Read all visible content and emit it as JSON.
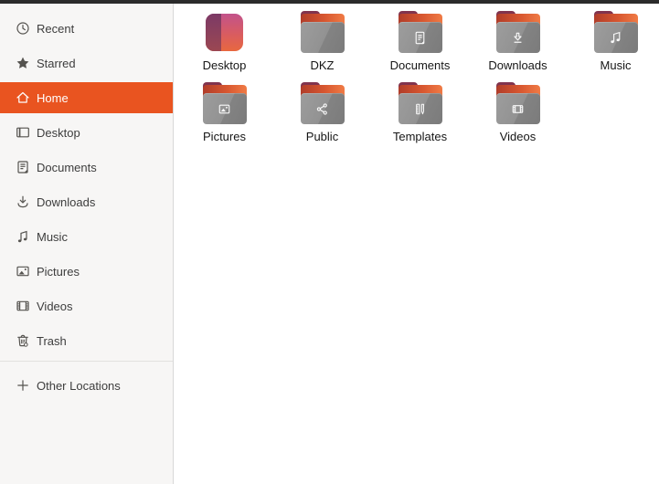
{
  "window": {
    "topbar_color": "#2b2b2b"
  },
  "sidebar": {
    "colors": {
      "background": "#f7f6f5",
      "selected_background": "#e95420",
      "text": "#3d3d3d",
      "selected_text": "#ffffff"
    },
    "items": [
      {
        "label": "Recent",
        "icon": "recent-icon",
        "selected": false
      },
      {
        "label": "Starred",
        "icon": "starred-icon",
        "selected": false
      },
      {
        "label": "Home",
        "icon": "home-icon",
        "selected": true
      },
      {
        "label": "Desktop",
        "icon": "desktop-icon",
        "selected": false
      },
      {
        "label": "Documents",
        "icon": "documents-icon",
        "selected": false
      },
      {
        "label": "Downloads",
        "icon": "downloads-icon",
        "selected": false
      },
      {
        "label": "Music",
        "icon": "music-icon",
        "selected": false
      },
      {
        "label": "Pictures",
        "icon": "pictures-icon",
        "selected": false
      },
      {
        "label": "Videos",
        "icon": "videos-icon",
        "selected": false
      },
      {
        "label": "Trash",
        "icon": "trash-icon",
        "selected": false
      }
    ],
    "other_locations": {
      "label": "Other Locations",
      "icon": "plus-icon"
    }
  },
  "main": {
    "colors": {
      "folder_front": "#8c8c8c",
      "folder_tab": "#81344e",
      "folder_back_orange": "#e0582f",
      "label_text": "#161616"
    },
    "folders": [
      {
        "label": "Desktop",
        "icon_type": "desktop-gradient",
        "emblem": "none"
      },
      {
        "label": "DKZ",
        "icon_type": "folder",
        "emblem": "none"
      },
      {
        "label": "Documents",
        "icon_type": "folder",
        "emblem": "document"
      },
      {
        "label": "Downloads",
        "icon_type": "folder",
        "emblem": "download"
      },
      {
        "label": "Music",
        "icon_type": "folder",
        "emblem": "music"
      },
      {
        "label": "Pictures",
        "icon_type": "folder",
        "emblem": "image"
      },
      {
        "label": "Public",
        "icon_type": "folder",
        "emblem": "share"
      },
      {
        "label": "Templates",
        "icon_type": "folder",
        "emblem": "template"
      },
      {
        "label": "Videos",
        "icon_type": "folder",
        "emblem": "video"
      }
    ]
  }
}
